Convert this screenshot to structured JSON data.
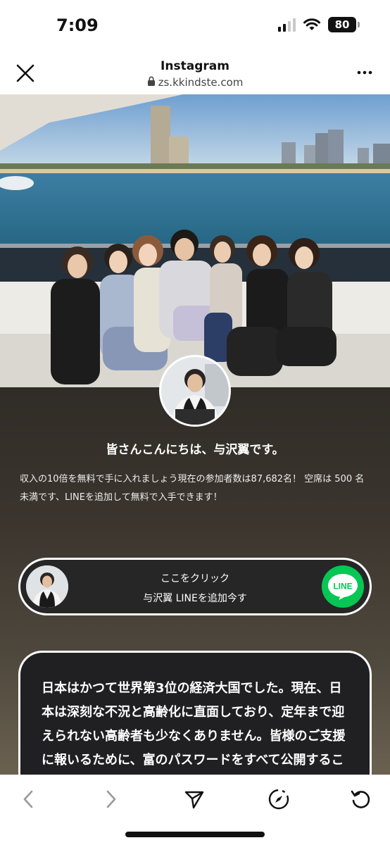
{
  "status_bar": {
    "time": "7:09",
    "battery": "80"
  },
  "browser": {
    "title": "Instagram",
    "url": "zs.kkindste.com",
    "close_icon": "close-icon",
    "more_icon": "more-icon"
  },
  "profile": {
    "greeting": "皆さんこんにちは、与沢翼です。",
    "description": "収入の10倍を無料で手に入れましょう現在の参加者数は87,682名！ 空席は 500 名未満です、LINEを追加して無料で入手できます！"
  },
  "cta": {
    "line1": "ここをクリック",
    "line2": "与沢翼 LINEを追加今す",
    "logo_text": "LINE",
    "logo_color": "#06c755"
  },
  "info_card": {
    "text": "日本はかつて世界第3位の経済大国でした。現在、日本は深刻な不況と高齢化に直面しており、定年まで迎えられない高齢者も少なくありません。皆様のご支援に報いるために、富のパスワードをすべて公開することにしました。"
  },
  "toolbar": {
    "back_icon": "chevron-left-icon",
    "forward_icon": "chevron-right-icon",
    "share_icon": "send-icon",
    "compass_icon": "compass-icon",
    "reload_icon": "reload-icon"
  }
}
